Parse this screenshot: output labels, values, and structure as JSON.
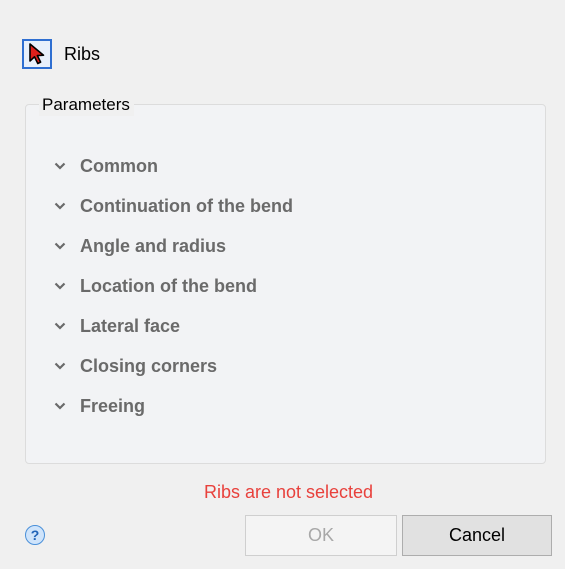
{
  "header": {
    "label": "Ribs",
    "select_icon": "cursor-arrow-icon"
  },
  "parameters": {
    "title": "Parameters",
    "sections": [
      {
        "label": "Common",
        "icon": "chevron-down-icon"
      },
      {
        "label": "Continuation of the bend",
        "icon": "chevron-down-icon"
      },
      {
        "label": "Angle and radius",
        "icon": "chevron-down-icon"
      },
      {
        "label": "Location of the bend",
        "icon": "chevron-down-icon"
      },
      {
        "label": "Lateral face",
        "icon": "chevron-down-icon"
      },
      {
        "label": "Closing corners",
        "icon": "chevron-down-icon"
      },
      {
        "label": "Freeing",
        "icon": "chevron-down-icon"
      }
    ]
  },
  "status": {
    "message": "Ribs are not selected",
    "color": "#e8413c"
  },
  "footer": {
    "help_label": "?",
    "ok_label": "OK",
    "ok_enabled": false,
    "cancel_label": "Cancel"
  },
  "colors": {
    "accent": "#2f6fd1",
    "section_text": "#6a6a6a",
    "cursor_fill": "#e0201b"
  }
}
